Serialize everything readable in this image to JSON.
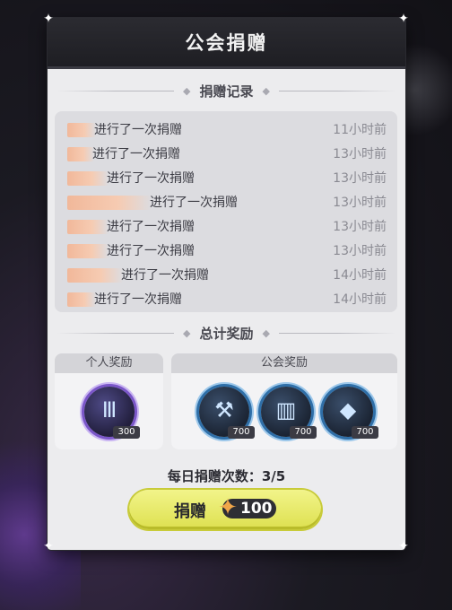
{
  "header": {
    "title": "公会捐赠"
  },
  "records_section": {
    "title": "捐赠记录",
    "items": [
      {
        "text": "进行了一次捐赠",
        "time": "11小时前"
      },
      {
        "text": "进行了一次捐赠",
        "time": "13小时前"
      },
      {
        "text": "进行了一次捐赠",
        "time": "13小时前"
      },
      {
        "text": "进行了一次捐赠",
        "time": "13小时前"
      },
      {
        "text": "进行了一次捐赠",
        "time": "13小时前"
      },
      {
        "text": "进行了一次捐赠",
        "time": "13小时前"
      },
      {
        "text": "进行了一次捐赠",
        "time": "14小时前"
      },
      {
        "text": "进行了一次捐赠",
        "time": "14小时前"
      }
    ]
  },
  "rewards_section": {
    "title": "总计奖励",
    "personal": {
      "label": "个人奖励",
      "items": [
        {
          "icon": "emblem-coin-icon",
          "qty": "300"
        }
      ]
    },
    "guild": {
      "label": "公会奖励",
      "items": [
        {
          "icon": "anvil-icon",
          "qty": "700"
        },
        {
          "icon": "scroll-icon",
          "qty": "700"
        },
        {
          "icon": "crystal-icon",
          "qty": "700"
        }
      ]
    }
  },
  "daily": {
    "text": "每日捐赠次数：3/5"
  },
  "donate_button": {
    "label": "捐赠",
    "cost_icon": "star-gem-icon",
    "cost": "100"
  },
  "colors": {
    "accent": "#dde04f",
    "panel": "#ececee",
    "header": "#1e1e23"
  }
}
